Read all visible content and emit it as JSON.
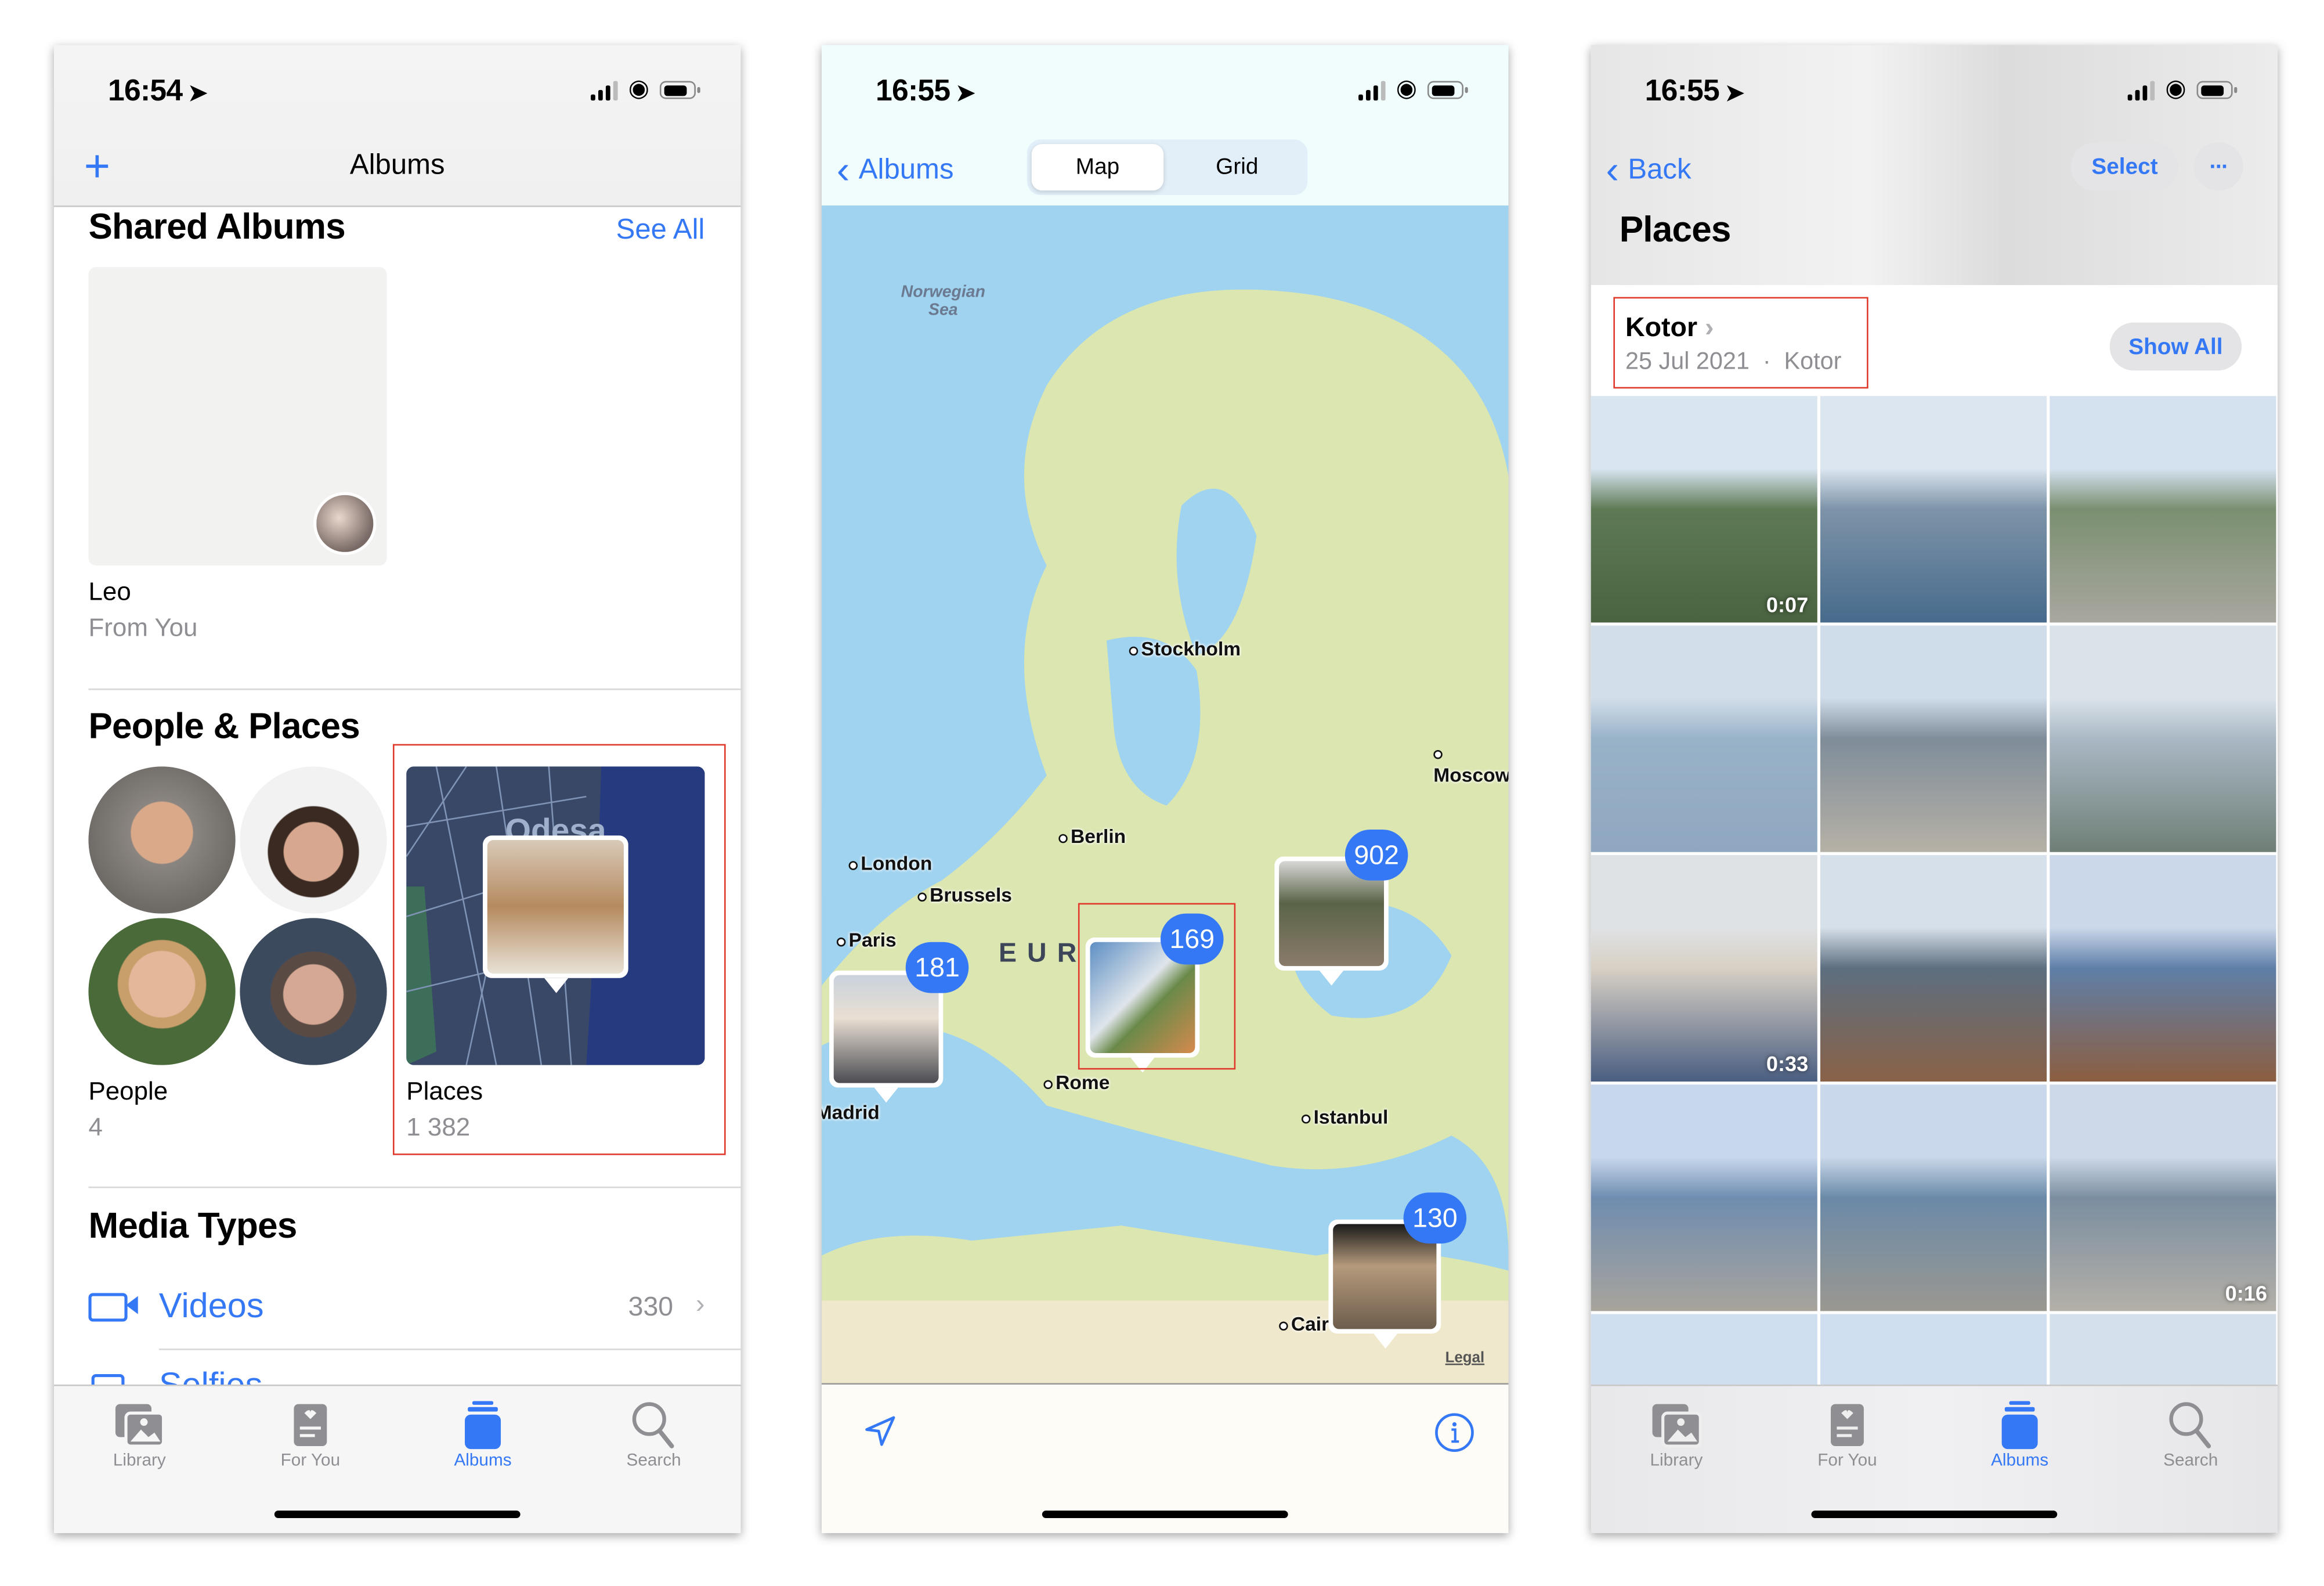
{
  "panels": {
    "albums": {
      "status": {
        "time": "16:54"
      },
      "nav": {
        "title": "Albums",
        "add_icon": "plus-icon"
      },
      "shared": {
        "heading": "Shared Albums",
        "see_all": "See All",
        "album": {
          "name": "Leo",
          "owner": "From You"
        }
      },
      "people_places": {
        "heading": "People & Places",
        "people": {
          "label": "People",
          "count": "4"
        },
        "places": {
          "label": "Places",
          "count": "1 382",
          "map_label": "Odesa"
        }
      },
      "media_types": {
        "heading": "Media Types",
        "items": [
          {
            "label": "Videos",
            "count": "330",
            "icon": "video-icon"
          },
          {
            "label": "Selfies",
            "count": "",
            "icon": "selfie-icon"
          }
        ]
      }
    },
    "map": {
      "status": {
        "time": "16:55"
      },
      "nav": {
        "back": "Albums"
      },
      "segment": {
        "options": [
          "Map",
          "Grid"
        ],
        "selected": "Map"
      },
      "sea_label": "Norwegian Sea",
      "region_label": "EUROPE",
      "cities": [
        "Stockholm",
        "Moscow",
        "Berlin",
        "London",
        "Brussels",
        "Paris",
        "Rome",
        "Istanbul",
        "Madrid",
        "Cairo"
      ],
      "clusters": [
        {
          "count": "181"
        },
        {
          "count": "169"
        },
        {
          "count": "902"
        },
        {
          "count": "130"
        }
      ],
      "legal": "Legal"
    },
    "places": {
      "status": {
        "time": "16:55"
      },
      "nav": {
        "back": "Back",
        "select": "Select",
        "more": "···"
      },
      "title": "Places",
      "section": {
        "name": "Kotor",
        "date": "25 Jul 2021",
        "location": "Kotor",
        "separator": "·",
        "show_all": "Show All"
      },
      "durations": [
        "0:07",
        "",
        "",
        "",
        "",
        "",
        "0:33",
        "",
        "",
        "",
        "",
        "0:16",
        "",
        "",
        ""
      ]
    }
  },
  "tabbar": {
    "tabs": [
      {
        "label": "Library",
        "icon": "library-icon"
      },
      {
        "label": "For You",
        "icon": "for-you-icon"
      },
      {
        "label": "Albums",
        "icon": "albums-icon",
        "active": true
      },
      {
        "label": "Search",
        "icon": "search-icon"
      }
    ]
  },
  "colors": {
    "accent": "#3478f6",
    "highlight_box": "#e0392b"
  }
}
